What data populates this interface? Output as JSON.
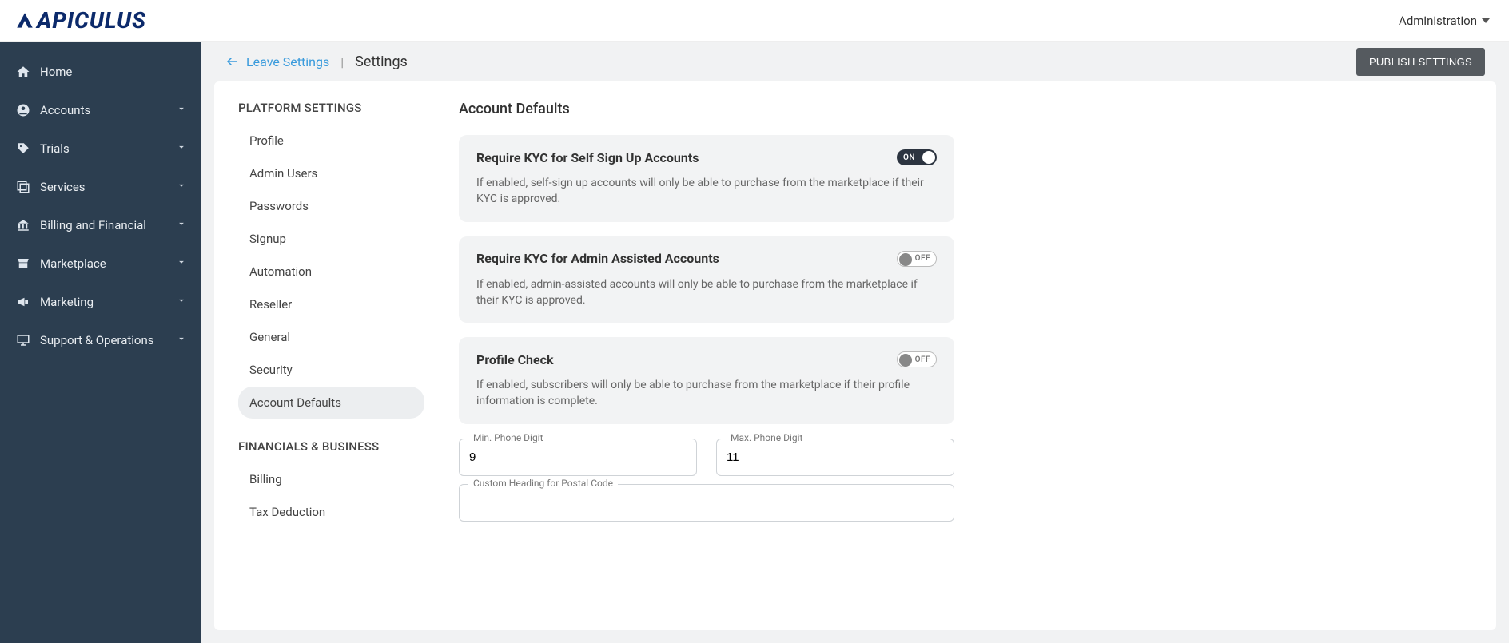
{
  "brand": "APICULUS",
  "topbar": {
    "admin_label": "Administration"
  },
  "sidebar": {
    "items": [
      {
        "label": "Home",
        "icon": "home",
        "expandable": false
      },
      {
        "label": "Accounts",
        "icon": "account",
        "expandable": true
      },
      {
        "label": "Trials",
        "icon": "tag",
        "expandable": true
      },
      {
        "label": "Services",
        "icon": "services",
        "expandable": true
      },
      {
        "label": "Billing and Financial",
        "icon": "bank",
        "expandable": true
      },
      {
        "label": "Marketplace",
        "icon": "store",
        "expandable": true
      },
      {
        "label": "Marketing",
        "icon": "megaphone",
        "expandable": true
      },
      {
        "label": "Support & Operations",
        "icon": "monitor",
        "expandable": true
      }
    ]
  },
  "header": {
    "leave_label": "Leave Settings",
    "title": "Settings",
    "publish_label": "PUBLISH SETTINGS"
  },
  "settings_nav": {
    "group1_title": "PLATFORM SETTINGS",
    "group1_items": [
      "Profile",
      "Admin Users",
      "Passwords",
      "Signup",
      "Automation",
      "Reseller",
      "General",
      "Security",
      "Account Defaults"
    ],
    "active_item": "Account Defaults",
    "group2_title": "FINANCIALS & BUSINESS",
    "group2_items": [
      "Billing",
      "Tax Deduction"
    ]
  },
  "page": {
    "title": "Account Defaults",
    "cards": [
      {
        "title": "Require KYC for Self Sign Up Accounts",
        "desc": "If enabled, self-sign up accounts will only be able to purchase from the marketplace if their KYC is approved.",
        "state": "ON"
      },
      {
        "title": "Require KYC for Admin Assisted Accounts",
        "desc": "If enabled, admin-assisted accounts will only be able to purchase from the marketplace if their KYC is approved.",
        "state": "OFF"
      },
      {
        "title": "Profile Check",
        "desc": "If enabled, subscribers will only be able to purchase from the marketplace if their profile information is complete.",
        "state": "OFF"
      }
    ],
    "fields": {
      "min_phone_label": "Min. Phone Digit",
      "min_phone_value": "9",
      "max_phone_label": "Max. Phone Digit",
      "max_phone_value": "11",
      "postal_heading_label": "Custom Heading for Postal Code",
      "postal_heading_value": ""
    }
  }
}
